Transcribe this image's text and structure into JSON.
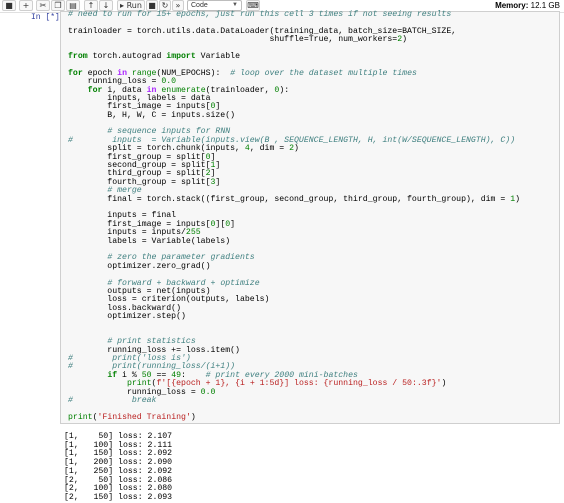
{
  "toolbar": {
    "buttons": [
      {
        "icon": "save-icon",
        "glyph": "💾"
      },
      {
        "icon": "add-cell-icon",
        "glyph": "+"
      },
      {
        "icon": "cut-icon",
        "glyph": "✂"
      },
      {
        "icon": "copy-icon",
        "glyph": "⧉"
      },
      {
        "icon": "paste-icon",
        "glyph": "📋"
      },
      {
        "icon": "move-up-icon",
        "glyph": "↑"
      },
      {
        "icon": "move-down-icon",
        "glyph": "↓"
      }
    ],
    "run_label": "Run",
    "run_icon": "play-icon",
    "stop_icon": "stop-icon",
    "restart_icon": "restart-icon",
    "restart_run_all_icon": "fast-forward-icon",
    "cell_type": "Code",
    "keyboard_icon": "keyboard-icon",
    "memory_label": "Memory:",
    "memory_value": "12.1 GB"
  },
  "cell": {
    "prompt": "In [*]:",
    "code_lines": [
      "# need to run for 15+ epochs, just run this cell 3 times if not seeing results",
      "",
      "trainloader = torch.utils.data.DataLoader(training_data, batch_size=BATCH_SIZE,",
      "                                         shuffle=True, num_workers=2)",
      "",
      "from torch.autograd import Variable",
      "",
      "for epoch in range(NUM_EPOCHS):  # loop over the dataset multiple times",
      "    running_loss = 0.0",
      "    for i, data in enumerate(trainloader, 0):",
      "        inputs, labels = data",
      "        first_image = inputs[0]",
      "        B, H, W, C = inputs.size()",
      "",
      "        # sequence inputs for RNN",
      "#        inputs  = Variable(inputs.view(B , SEQUENCE_LENGTH, H, int(W/SEQUENCE_LENGTH), C))",
      "        split = torch.chunk(inputs, 4, dim = 2)",
      "        first_group = split[0]",
      "        second_group = split[1]",
      "        third_group = split[2]",
      "        fourth_group = split[3]",
      "        # merge",
      "        final = torch.stack((first_group, second_group, third_group, fourth_group), dim = 1)",
      "",
      "        inputs = final",
      "        first_image = inputs[0][0]",
      "        inputs = inputs/255",
      "        labels = Variable(labels)",
      "",
      "        # zero the parameter gradients",
      "        optimizer.zero_grad()",
      "",
      "        # forward + backward + optimize",
      "        outputs = net(inputs)",
      "        loss = criterion(outputs, labels)",
      "        loss.backward()",
      "        optimizer.step()",
      "",
      "",
      "        # print statistics",
      "        running_loss += loss.item()",
      "#        print('loss is')",
      "#        print(running_loss/(i+1))",
      "        if i % 50 == 49:    # print every 2000 mini-batches",
      "            print(f'[{epoch + 1}, {i + 1:5d}] loss: {running_loss / 50:.3f}')",
      "            running_loss = 0.0",
      "#            break",
      "",
      "print('Finished Training')"
    ],
    "output_lines": [
      "[1,    50] loss: 2.107",
      "[1,   100] loss: 2.111",
      "[1,   150] loss: 2.092",
      "[1,   200] loss: 2.090",
      "[1,   250] loss: 2.092",
      "[2,    50] loss: 2.086",
      "[2,   100] loss: 2.080",
      "[2,   150] loss: 2.093"
    ]
  }
}
